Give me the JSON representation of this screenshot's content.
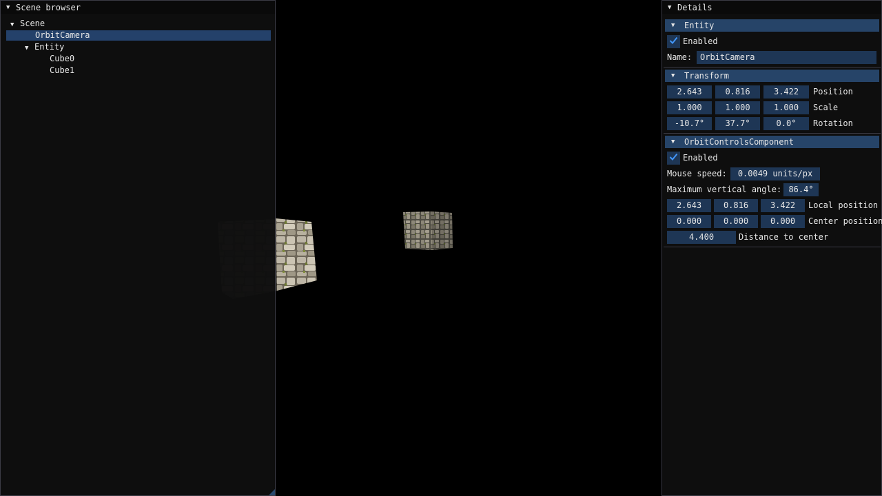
{
  "scene_browser": {
    "title": "Scene browser",
    "tree": [
      {
        "label": "Scene",
        "arrow": "▼"
      },
      {
        "label": "OrbitCamera",
        "arrow": ""
      },
      {
        "label": "Entity",
        "arrow": "▼"
      },
      {
        "label": "Cube0",
        "arrow": ""
      },
      {
        "label": "Cube1",
        "arrow": ""
      }
    ]
  },
  "details": {
    "title": "Details",
    "entity": {
      "header": "Entity",
      "enabled_label": "Enabled",
      "name_label": "Name:",
      "name_value": "OrbitCamera"
    },
    "transform": {
      "header": "Transform",
      "position": {
        "x": "2.643",
        "y": "0.816",
        "z": "3.422",
        "label": "Position"
      },
      "scale": {
        "x": "1.000",
        "y": "1.000",
        "z": "1.000",
        "label": "Scale"
      },
      "rotation": {
        "x": "-10.7°",
        "y": "37.7°",
        "z": "0.0°",
        "label": "Rotation"
      }
    },
    "orbit": {
      "header": "OrbitControlsComponent",
      "enabled_label": "Enabled",
      "mouse_speed_label": "Mouse speed:",
      "mouse_speed_value": "0.0049 units/px",
      "max_angle_label": "Maximum vertical angle:",
      "max_angle_value": "86.4°",
      "local_position": {
        "x": "2.643",
        "y": "0.816",
        "z": "3.422",
        "label": "Local position"
      },
      "center_position": {
        "x": "0.000",
        "y": "0.000",
        "z": "0.000",
        "label": "Center position"
      },
      "distance_value": "4.400",
      "distance_label": "Distance to center"
    }
  },
  "symbols": {
    "expanded_arrow": "▼"
  },
  "icons": {
    "check": "checkmark-icon",
    "expand": "triangle-down-icon",
    "stone_texture": "stone-texture"
  },
  "colors": {
    "background": "#000000",
    "window_bg": "#0f0f0f",
    "header_bg": "#264468",
    "field_bg": "#1e3655",
    "selected_bg": "#24416a",
    "check_color": "#4296fa"
  }
}
